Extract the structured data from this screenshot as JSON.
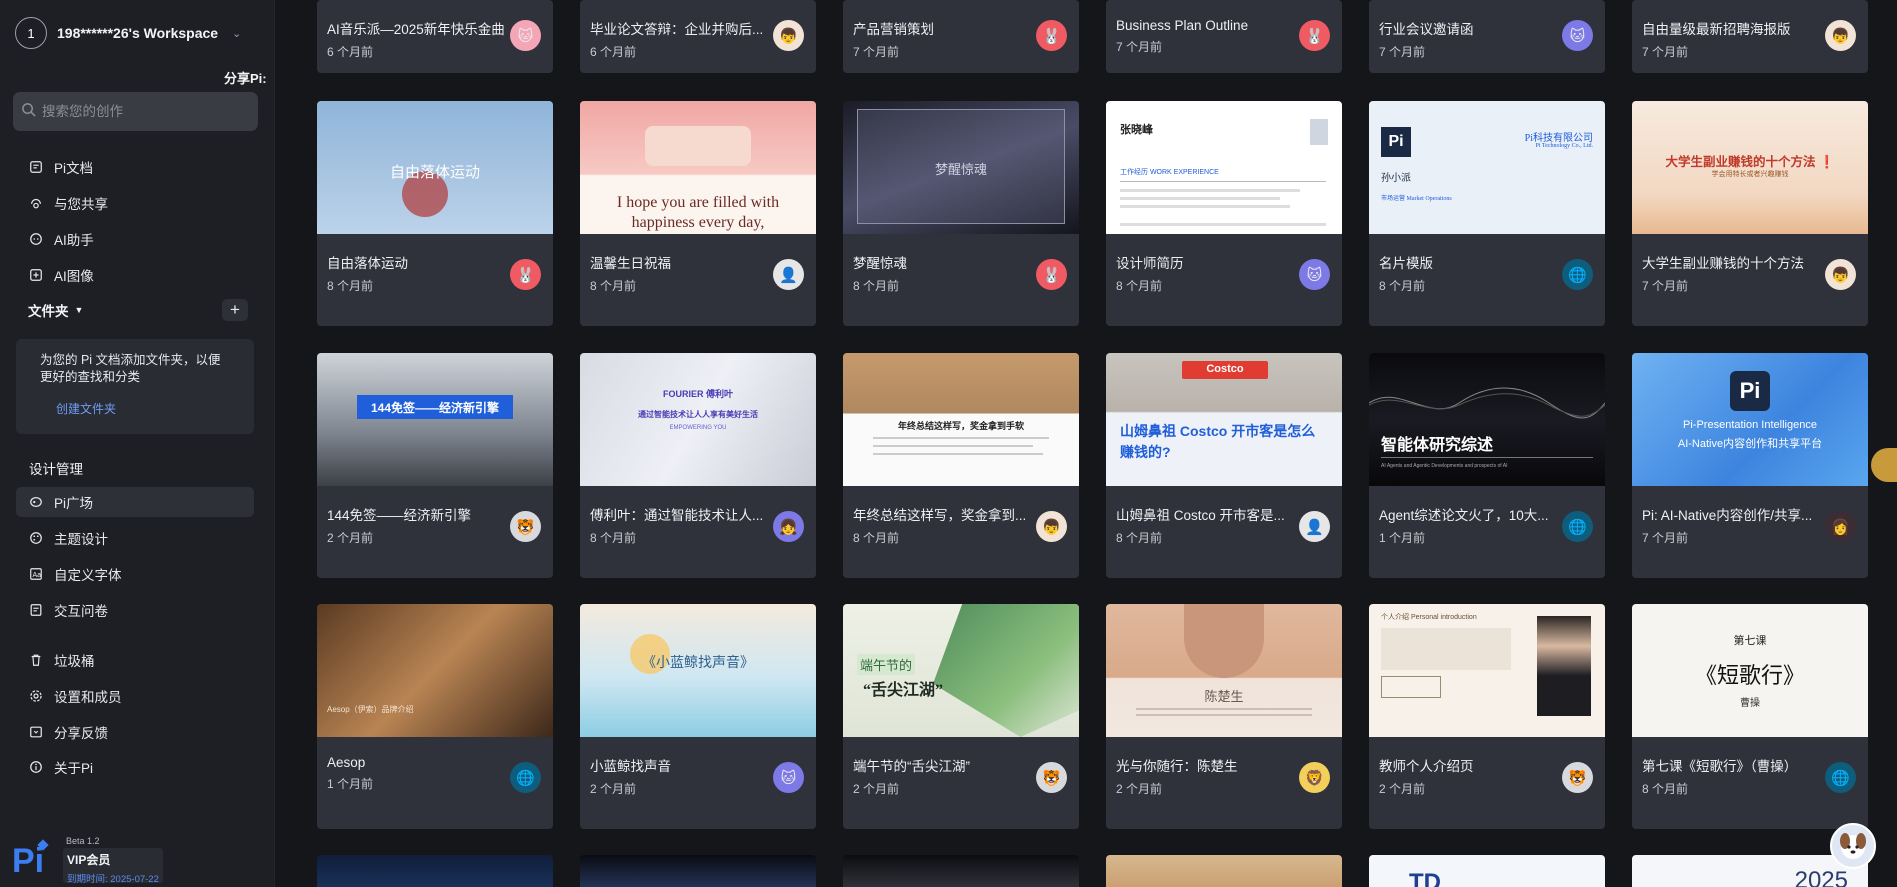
{
  "workspace": {
    "avatar_initial": "1",
    "name": "198******26's Workspace"
  },
  "share_label": "分享Pi:",
  "search": {
    "placeholder": "搜索您的创作"
  },
  "nav_top": [
    {
      "label": "Pi文档",
      "icon": "document-icon"
    },
    {
      "label": "与您共享",
      "icon": "share-icon"
    },
    {
      "label": "AI助手",
      "icon": "chat-icon"
    },
    {
      "label": "AI图像",
      "icon": "image-plus-icon"
    }
  ],
  "folders": {
    "label": "文件夹",
    "add_symbol": "+",
    "tip": "为您的 Pi 文档添加文件夹，以便更好的查找和分类",
    "create_link": "创建文件夹"
  },
  "design_section": "设计管理",
  "nav_bottom": [
    {
      "label": "Pi广场",
      "icon": "plaza-icon",
      "active": true
    },
    {
      "label": "主题设计",
      "icon": "palette-icon"
    },
    {
      "label": "自定义字体",
      "icon": "font-icon"
    },
    {
      "label": "交互问卷",
      "icon": "survey-icon"
    },
    {
      "label": "垃圾桶",
      "icon": "trash-icon"
    },
    {
      "label": "设置和成员",
      "icon": "settings-icon"
    },
    {
      "label": "分享反馈",
      "icon": "feedback-icon"
    },
    {
      "label": "关于Pi",
      "icon": "info-icon"
    }
  ],
  "version": "Beta 1.2",
  "vip": {
    "title": "VIP会员",
    "expiry": "到期时间: 2025-07-22"
  },
  "row0": [
    {
      "title": "AI音乐派—2025新年快乐金曲",
      "time": "6 个月前",
      "avatar": "pink"
    },
    {
      "title": "毕业论文答辩：企业并购后...",
      "time": "6 个月前",
      "avatar": "boy"
    },
    {
      "title": "产品营销策划",
      "time": "7 个月前",
      "avatar": "bunny"
    },
    {
      "title": "Business Plan Outline",
      "time": "7 个月前",
      "avatar": "bunny"
    },
    {
      "title": "行业会议邀请函",
      "time": "7 个月前",
      "avatar": "cat"
    },
    {
      "title": "自由量级最新招聘海报版",
      "time": "7 个月前",
      "avatar": "boy"
    }
  ],
  "row1": [
    {
      "title": "自由落体运动",
      "time": "8 个月前",
      "avatar": "bunny",
      "thumb": "自由落体运动"
    },
    {
      "title": "温馨生日祝福",
      "time": "8 个月前",
      "avatar": "bw",
      "thumb": "I hope you are filled with happiness every day,"
    },
    {
      "title": "梦醒惊魂",
      "time": "8 个月前",
      "avatar": "bunny",
      "thumb": "梦醒惊魂"
    },
    {
      "title": "设计师简历",
      "time": "8 个月前",
      "avatar": "cat",
      "thumb_name": "张晓峰",
      "thumb_section": "工作经历 WORK EXPERIENCE"
    },
    {
      "title": "名片模版",
      "time": "8 个月前",
      "avatar": "planet",
      "thumb_company": "Pi科技有限公司",
      "thumb_en": "Pi Technology Co., Ltd.",
      "thumb_person": "孙小派",
      "thumb_role": "市场运营 Market Operations"
    },
    {
      "title": "大学生副业赚钱的十个方法",
      "time": "7 个月前",
      "avatar": "boy",
      "thumb": "大学生副业赚钱的十个方法 ❗",
      "thumb_sub": "学会用特长或者兴趣赚钱"
    }
  ],
  "row2": [
    {
      "title": "144免签——经济新引擎",
      "time": "2 个月前",
      "avatar": "tiger",
      "thumb": "144免签——经济新引擎"
    },
    {
      "title": "傅利叶：通过智能技术让人...",
      "time": "8 个月前",
      "avatar": "girl-blue",
      "thumb_brand": "FOURIER 傅利叶",
      "thumb": "通过智能技术让人人享有美好生活",
      "thumb_sub": "EMPOWERING YOU"
    },
    {
      "title": "年终总结这样写，奖金拿到...",
      "time": "8 个月前",
      "avatar": "boy",
      "thumb": "年终总结这样写，奖金拿到手软"
    },
    {
      "title": "山姆鼻祖 Costco 开市客是...",
      "time": "8 个月前",
      "avatar": "bw",
      "thumb_store": "Costco",
      "thumb": "山姆鼻祖 Costco 开市客是怎么赚钱的?"
    },
    {
      "title": "Agent综述论文火了，10大...",
      "time": "1 个月前",
      "avatar": "planet",
      "thumb": "智能体研究综述",
      "thumb_sub": "AI Agents and Agentic Developments and prospects of AI"
    },
    {
      "title": "Pi: AI-Native内容创作/共享...",
      "time": "7 个月前",
      "avatar": "girl",
      "thumb": "Pi-Presentation Intelligence",
      "thumb_sub": "AI-Native内容创作和共享平台"
    }
  ],
  "row3": [
    {
      "title": "Aesop",
      "time": "1 个月前",
      "avatar": "planet",
      "thumb": "Aesop（伊索）品牌介绍"
    },
    {
      "title": "小蓝鲸找声音",
      "time": "2 个月前",
      "avatar": "cat",
      "thumb": "《小蓝鲸找声音》"
    },
    {
      "title": "端午节的“舌尖江湖”",
      "time": "2 个月前",
      "avatar": "tiger",
      "thumb_a": "端午节的",
      "thumb_b": "“舌尖江湖”"
    },
    {
      "title": "光与你随行：陈楚生",
      "time": "2 个月前",
      "avatar": "gold",
      "thumb": "陈楚生"
    },
    {
      "title": "教师个人介绍页",
      "time": "2 个月前",
      "avatar": "tiger",
      "thumb": "个人介绍 Personal introduction"
    },
    {
      "title": "第七课《短歌行》（曹操）",
      "time": "8 个月前",
      "avatar": "planet",
      "thumb_a": "第七课",
      "thumb_b": "《短歌行》",
      "thumb_c": "曹操"
    }
  ],
  "row4_thumbs": [
    "",
    "",
    "",
    "",
    "TD",
    "2025"
  ]
}
